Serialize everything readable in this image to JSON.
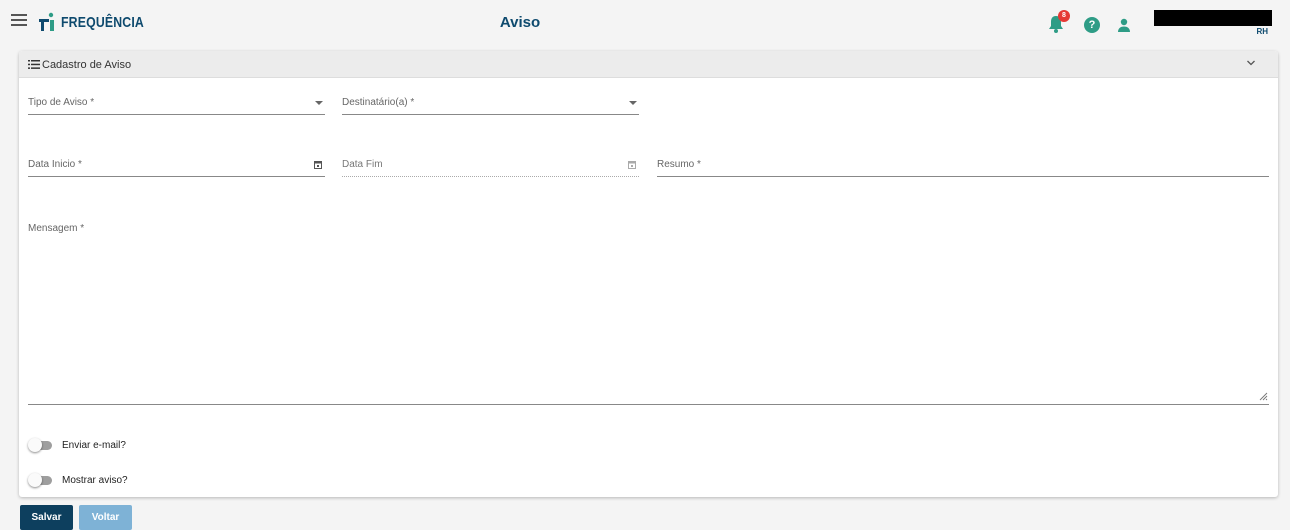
{
  "app": {
    "brand": "FREQUÊNCIA",
    "page_title": "Aviso",
    "notification_count": "8",
    "help_symbol": "?",
    "user_role": "RH"
  },
  "form": {
    "title": "Cadastro de Aviso",
    "fields": {
      "tipo_aviso": "Tipo de Aviso *",
      "destinatario": "Destinatário(a) *",
      "data_inicio": "Data Inicio *",
      "data_fim": "Data Fim",
      "resumo": "Resumo *",
      "mensagem": "Mensagem *"
    },
    "toggles": {
      "enviar_email": "Enviar e-mail?",
      "mostrar_aviso": "Mostrar aviso?"
    }
  },
  "actions": {
    "save": "Salvar",
    "back": "Voltar"
  },
  "colors": {
    "brand": "#0e4a6e",
    "accent": "#2e9c86",
    "badge": "#e53935",
    "save_button": "#0d3f5e",
    "back_button": "#7eb2d6"
  },
  "icons": [
    "menu-icon",
    "bell-icon",
    "help-icon",
    "user-icon",
    "list-icon",
    "chevron-down-icon",
    "calendar-icon",
    "resize-handle-icon"
  ]
}
